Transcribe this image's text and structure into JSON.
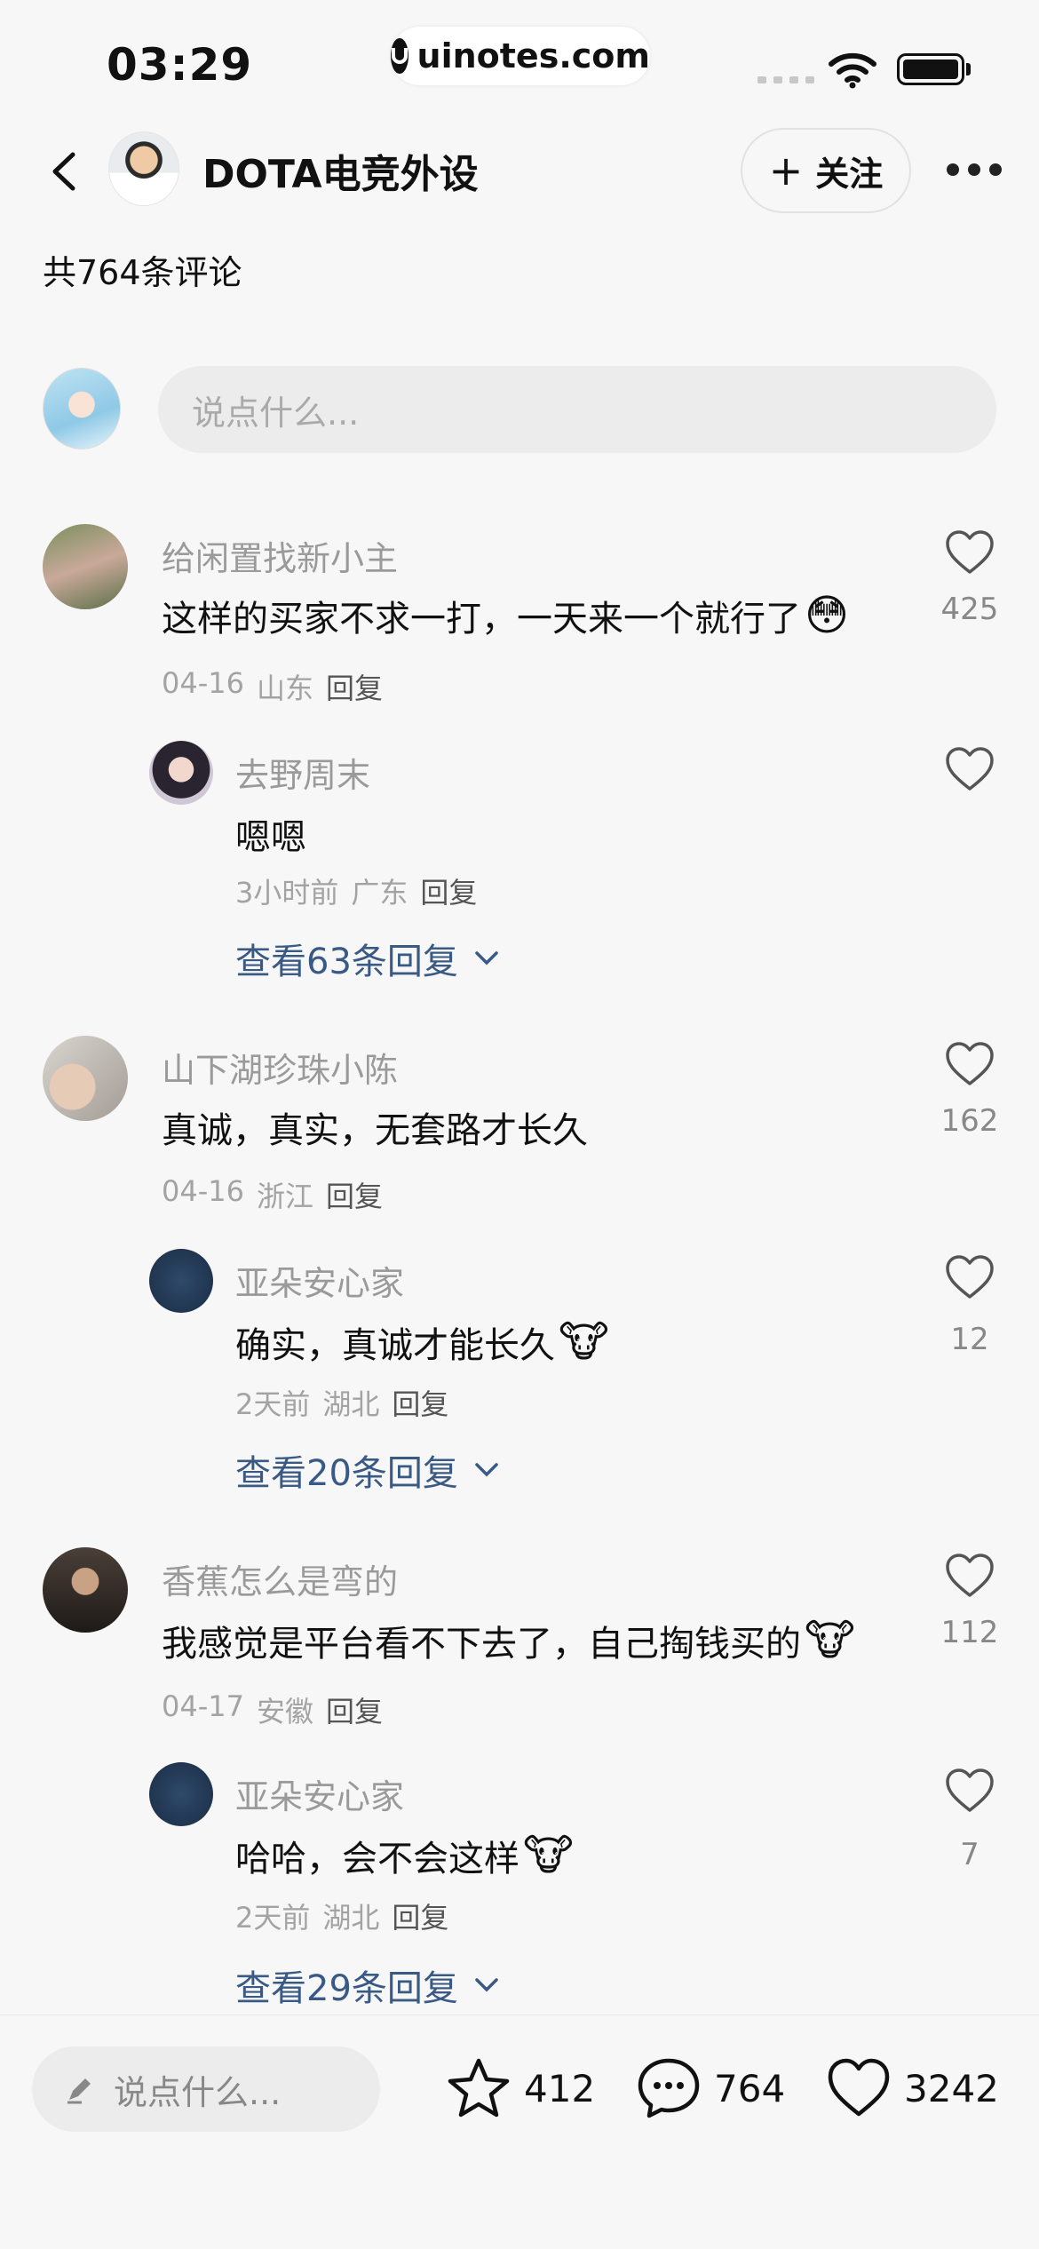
{
  "status_bar": {
    "time": "03:29",
    "watermark": "uinotes.com"
  },
  "header": {
    "author_name": "DOTA电竞外设",
    "follow_label": "关注"
  },
  "comment_count": "共764条评论",
  "composer": {
    "placeholder": "说点什么..."
  },
  "comments": [
    {
      "name": "给闲置找新小主",
      "text": "这样的买家不求一打，一天来一个就行了",
      "emoji": "😳",
      "date": "04-16",
      "location": "山东",
      "reply": "回复",
      "likes": "425",
      "sub": {
        "name": "去野周末",
        "text": "嗯嗯",
        "date": "3小时前",
        "location": "广东",
        "reply": "回复",
        "likes": ""
      },
      "view_more": "查看63条回复"
    },
    {
      "name": "山下湖珍珠小陈",
      "text": "真诚，真实，无套路才长久",
      "emoji": "",
      "date": "04-16",
      "location": "浙江",
      "reply": "回复",
      "likes": "162",
      "sub": {
        "name": "亚朵安心家",
        "text": "确实，真诚才能长久",
        "emoji": "🐮",
        "date": "2天前",
        "location": "湖北",
        "reply": "回复",
        "likes": "12"
      },
      "view_more": "查看20条回复"
    },
    {
      "name": "香蕉怎么是弯的",
      "text": "我感觉是平台看不下去了，自己掏钱买的",
      "emoji": "🐮",
      "date": "04-17",
      "location": "安徽",
      "reply": "回复",
      "likes": "112",
      "sub": {
        "name": "亚朵安心家",
        "text": "哈哈，会不会这样",
        "emoji": "🐮",
        "date": "2天前",
        "location": "湖北",
        "reply": "回复",
        "likes": "7"
      },
      "view_more": "查看29条回复"
    }
  ],
  "bottom_bar": {
    "placeholder": "说点什么...",
    "favorites": "412",
    "comments": "764",
    "likes": "3242"
  }
}
